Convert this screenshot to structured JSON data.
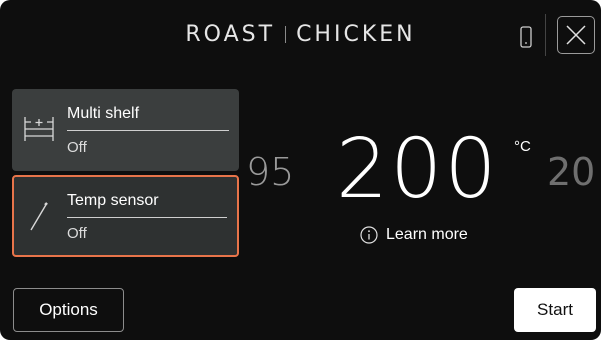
{
  "header": {
    "title_left": "ROAST",
    "title_right": "CHICKEN",
    "phone_icon": "phone-icon",
    "close_icon": "close-icon"
  },
  "panels": [
    {
      "label": "Multi shelf",
      "value": "Off",
      "icon": "multi-shelf-icon"
    },
    {
      "label": "Temp sensor",
      "value": "Off",
      "icon": "temp-sensor-icon",
      "selected": true
    }
  ],
  "temperature": {
    "prev": "95",
    "current": "200",
    "unit": "°C",
    "next": "20"
  },
  "learn_more": {
    "label": "Learn more",
    "icon": "info-icon"
  },
  "footer": {
    "options_label": "Options",
    "start_label": "Start"
  },
  "colors": {
    "background": "#0e0e0e",
    "accent": "#e8744a",
    "panel": "#3b3e3e"
  }
}
